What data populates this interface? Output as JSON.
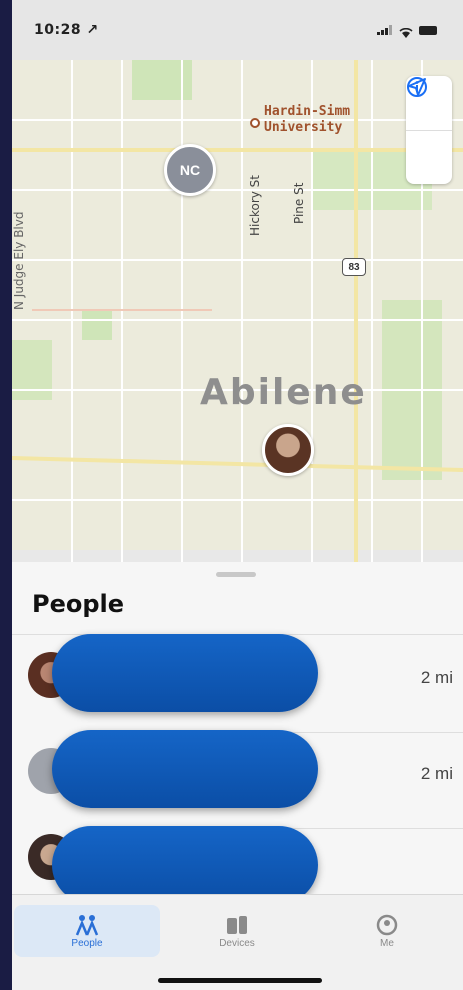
{
  "status_bar": {
    "time": "10:28 ↗"
  },
  "map": {
    "city": "Abilene",
    "university_line1": "Hardin-Simm",
    "university_line2": "University",
    "street_labels": [
      "Hickory St",
      "Pine St",
      "N Judge Ely Blvd"
    ],
    "road_shield": "83",
    "pin_initials": "NC",
    "info_icon": "info-icon",
    "location_icon": "location-arrow-icon"
  },
  "sheet": {
    "title": "People",
    "people": [
      {
        "distance": "2 mi",
        "avatar": "photo"
      },
      {
        "distance": "2 mi",
        "avatar": "initials-gray"
      },
      {
        "distance": "",
        "avatar": "photo"
      }
    ]
  },
  "tabs": [
    {
      "label": "People",
      "icon": "people-icon",
      "active": true
    },
    {
      "label": "Devices",
      "icon": "devices-icon",
      "active": false
    },
    {
      "label": "Me",
      "icon": "me-icon",
      "active": false
    }
  ],
  "colors": {
    "accent": "#2a6fd6",
    "redaction": "#0b4ea6",
    "background": "#1a1c44"
  }
}
